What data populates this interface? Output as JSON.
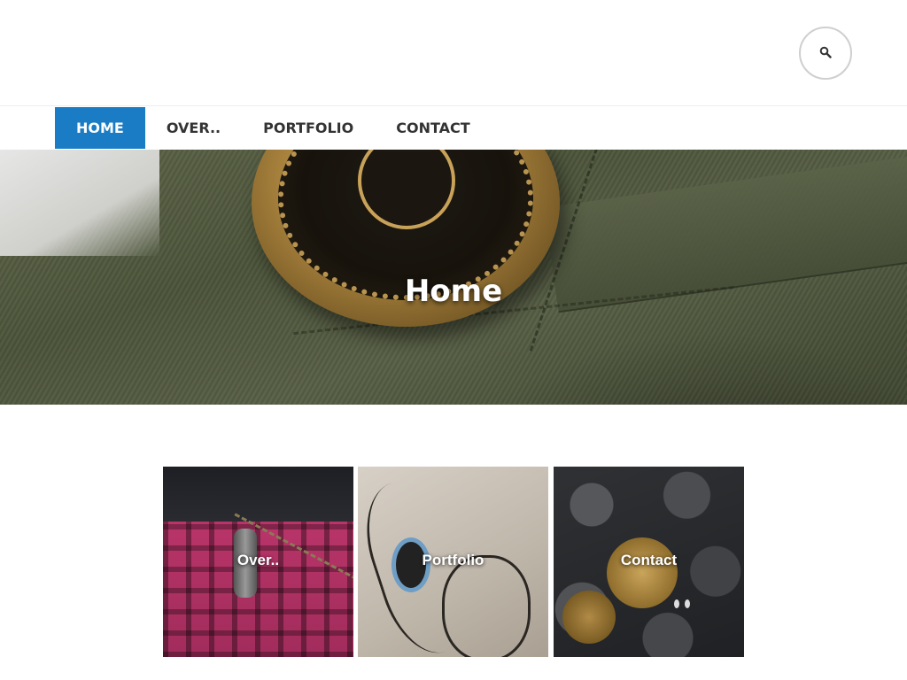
{
  "header": {
    "search_button_icon": "search-icon"
  },
  "nav": {
    "items": [
      {
        "label": "HOME",
        "active": true
      },
      {
        "label": "OVER..",
        "active": false
      },
      {
        "label": "PORTFOLIO",
        "active": false
      },
      {
        "label": "CONTACT",
        "active": false
      }
    ],
    "accent_color": "#1a7cc4"
  },
  "hero": {
    "title": "Home"
  },
  "tiles": [
    {
      "label": "Over.."
    },
    {
      "label": "Portfolio"
    },
    {
      "label": "Contact"
    }
  ]
}
